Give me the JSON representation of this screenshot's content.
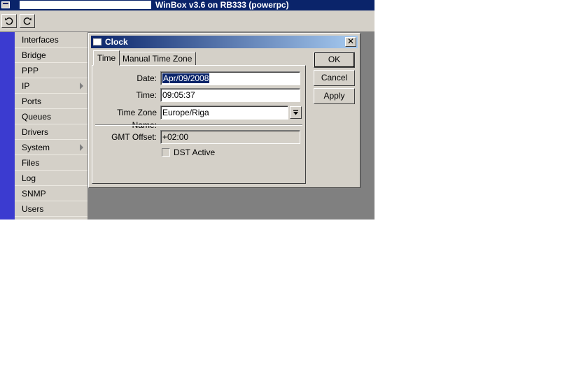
{
  "app": {
    "title": "WinBox v3.6 on RB333 (powerpc)"
  },
  "toolbar": {
    "undo_icon": "undo-icon",
    "redo_icon": "redo-icon"
  },
  "menu": {
    "items": [
      {
        "label": "Interfaces",
        "submenu": false
      },
      {
        "label": "Bridge",
        "submenu": false
      },
      {
        "label": "PPP",
        "submenu": false
      },
      {
        "label": "IP",
        "submenu": true
      },
      {
        "label": "Ports",
        "submenu": false
      },
      {
        "label": "Queues",
        "submenu": false
      },
      {
        "label": "Drivers",
        "submenu": false
      },
      {
        "label": "System",
        "submenu": true
      },
      {
        "label": "Files",
        "submenu": false
      },
      {
        "label": "Log",
        "submenu": false
      },
      {
        "label": "SNMP",
        "submenu": false
      },
      {
        "label": "Users",
        "submenu": false
      }
    ]
  },
  "dialog": {
    "title": "Clock",
    "close_glyph": "✕",
    "tabs": [
      {
        "label": "Time",
        "active": true
      },
      {
        "label": "Manual Time Zone",
        "active": false
      }
    ],
    "fields": {
      "date": {
        "label": "Date:",
        "value": "Apr/09/2008"
      },
      "time": {
        "label": "Time:",
        "value": "09:05:37"
      },
      "time_zone": {
        "label": "Time Zone Name:",
        "value": "Europe/Riga"
      },
      "gmt_offset": {
        "label": "GMT Offset:",
        "value": "+02:00"
      },
      "dst_active": {
        "label": "DST Active",
        "checked": false
      }
    },
    "buttons": {
      "ok": "OK",
      "cancel": "Cancel",
      "apply": "Apply"
    }
  },
  "colors": {
    "titlebar": "#0a246a",
    "face": "#d4d0c8",
    "workspace": "#808080",
    "leftbar": "#3b3bd0"
  }
}
